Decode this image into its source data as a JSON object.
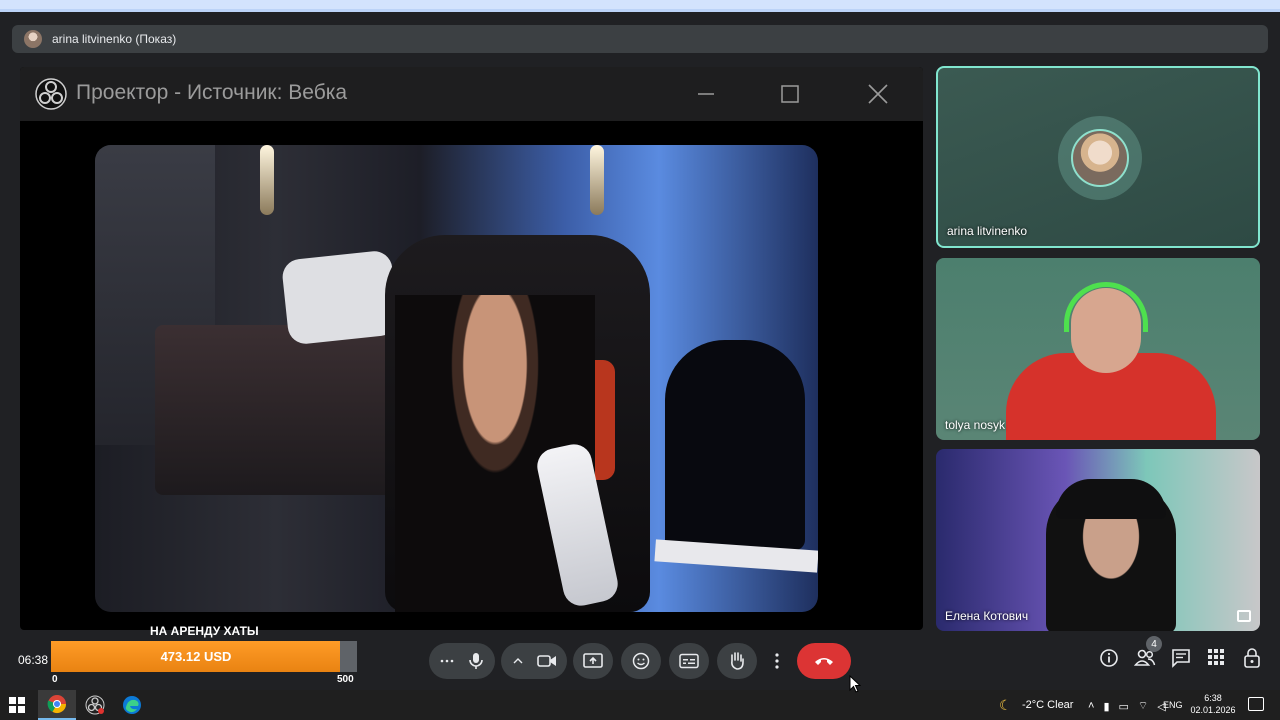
{
  "presenter_bar": {
    "name": "arina litvinenko (Показ)"
  },
  "projector": {
    "title": "Проектор - Источник: Вебка"
  },
  "participants": [
    {
      "name": "arina litvinenko"
    },
    {
      "name": "tolya nosyk"
    },
    {
      "name": "Елена Котович"
    }
  ],
  "donation": {
    "title": "НА АРЕНДУ ХАТЫ",
    "amount": "473.12 USD",
    "min": "0",
    "max": "500",
    "progress_fraction": 0.946,
    "fill_color": "#f39018"
  },
  "call": {
    "clock": "06:38",
    "people_count": "4",
    "hangup_color": "#dc3434",
    "active_tile_border": "#81e6cf"
  },
  "taskbar": {
    "weather": "-2°C  Clear",
    "lang": "ENG",
    "time": "6:38",
    "date": "02.01.2026"
  }
}
